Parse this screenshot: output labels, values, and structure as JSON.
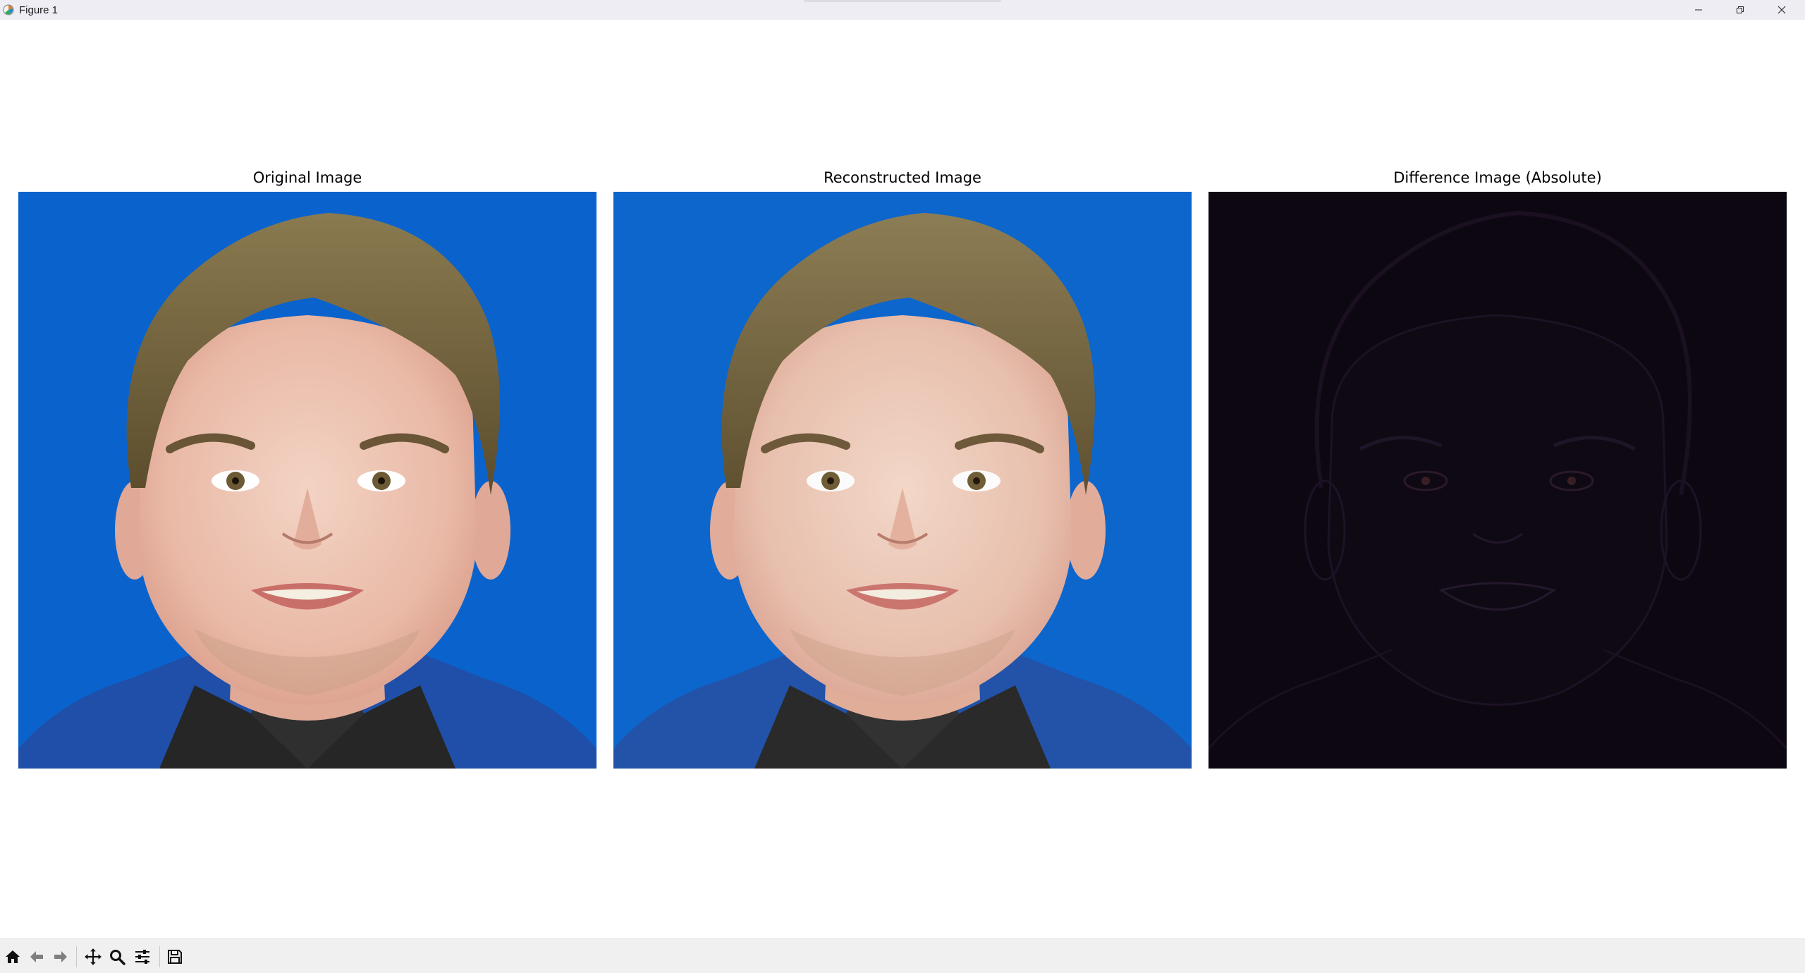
{
  "window": {
    "title": "Figure 1",
    "controls": [
      "minimize-icon",
      "restore-icon",
      "close-icon"
    ]
  },
  "figure": {
    "panels": [
      {
        "title": "Original Image",
        "content": "color portrait photo on blue background"
      },
      {
        "title": "Reconstructed Image",
        "content": "smoothed reconstruction of the portrait"
      },
      {
        "title": "Difference Image (Absolute)",
        "content": "near-black absolute difference map"
      }
    ]
  },
  "toolbar": {
    "tools": [
      "home-icon",
      "back-icon",
      "forward-icon",
      "pan-icon",
      "zoom-icon",
      "configure-subplots-icon",
      "save-icon"
    ]
  },
  "colors": {
    "titlebar_bg": "#efedf4",
    "toolbar_bg": "#f0f0f0",
    "photo_background_blue": "#0a63cc",
    "difference_background": "#0d0712"
  }
}
